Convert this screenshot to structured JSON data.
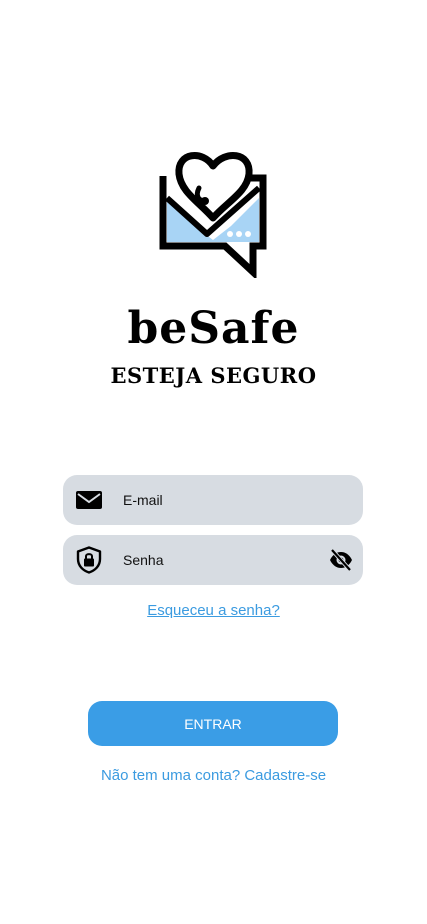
{
  "brand": {
    "name": "beSafe",
    "tagline": "ESTEJA SEGURO",
    "colors": {
      "accent": "#3a9de6",
      "logo_fill": "#a8d4f5",
      "field_bg": "#d7dce2"
    }
  },
  "form": {
    "email": {
      "placeholder": "E-mail",
      "value": "",
      "icon": "mail-icon"
    },
    "password": {
      "placeholder": "Senha",
      "value": "",
      "icon": "lock-shield-icon",
      "toggle_icon": "eye-off-icon"
    },
    "forgot_label": "Esqueceu a senha?",
    "submit_label": "ENTRAR",
    "signup_label": "Não tem uma conta? Cadastre-se"
  }
}
